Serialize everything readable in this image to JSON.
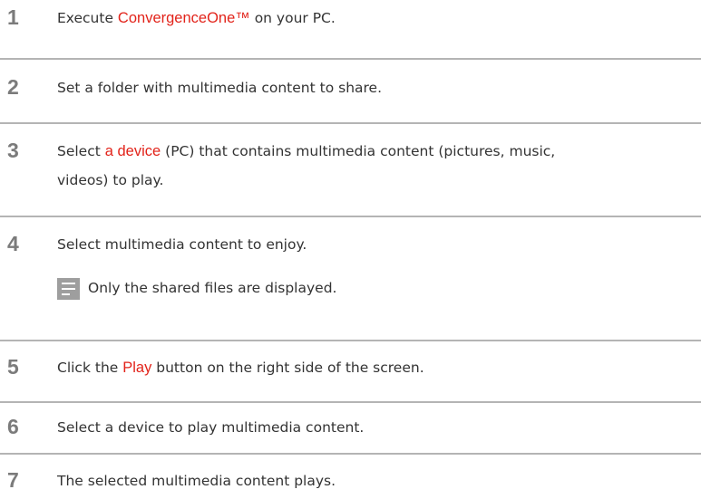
{
  "steps": [
    {
      "number": "1",
      "pre": "Execute ",
      "highlight": "ConvergenceOne™",
      "post": " on your PC."
    },
    {
      "number": "2",
      "text": "Set a folder with multimedia content to share."
    },
    {
      "number": "3",
      "pre": "Select ",
      "highlight": "a device",
      "post_line1": " (PC) that contains multimedia content (pictures, music,",
      "post_line2": "videos) to play."
    },
    {
      "number": "4",
      "text": "Select multimedia content to enjoy."
    },
    {
      "number": "5",
      "pre": "Click the ",
      "highlight": "Play",
      "post": " button on the right side of the screen."
    },
    {
      "number": "6",
      "text": "Select a device to play multimedia content."
    },
    {
      "number": "7",
      "text": "The selected multimedia content plays."
    }
  ],
  "note": {
    "icon": "note-icon",
    "text": "Only the shared files are displayed."
  },
  "colors": {
    "highlight": "#e2231a",
    "step_number": "#7b7b7b",
    "rule": "#b4b4b4",
    "note_icon": "#9e9e9e"
  }
}
